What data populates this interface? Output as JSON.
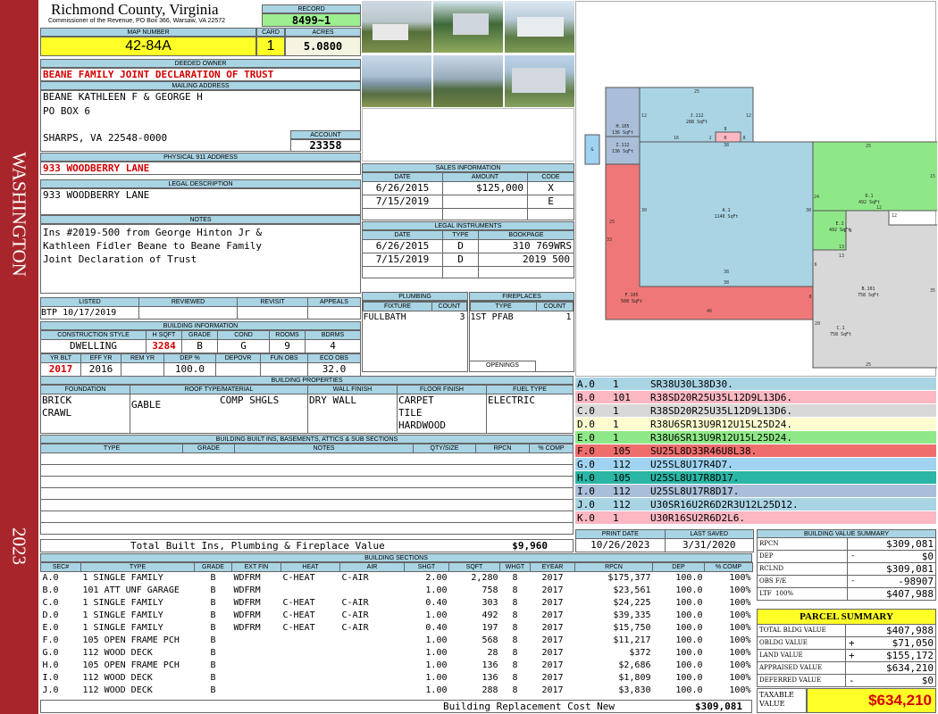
{
  "side": {
    "top": "WASHINGTON",
    "bottom": "2023"
  },
  "title": {
    "county": "Richmond County, Virginia",
    "sub": "Commissioner of the Revenue, PO Box 366, Warsaw, VA 22572"
  },
  "record": {
    "label": "RECORD",
    "value": "8499~1"
  },
  "map": {
    "map_label": "MAP NUMBER",
    "map_value": "42-84A",
    "card_label": "CARD",
    "card_value": "1",
    "acres_label": "ACRES",
    "acres_value": "5.0800"
  },
  "owner": {
    "label": "DEEDED OWNER",
    "value": "BEANE FAMILY JOINT DECLARATION OF TRUST"
  },
  "mailing": {
    "label": "MAILING ADDRESS",
    "line1": "BEANE KATHLEEN F & GEORGE H",
    "line2": "PO BOX 6",
    "line3": "SHARPS, VA 22548-0000"
  },
  "account": {
    "label": "ACCOUNT",
    "value": "23358"
  },
  "physical": {
    "label": "PHYSICAL 911 ADDRESS",
    "value": "933 WOODBERRY LANE"
  },
  "legal": {
    "label": "LEGAL DESCRIPTION",
    "value": "933 WOODBERRY LANE"
  },
  "notes": {
    "label": "NOTES",
    "lines": [
      "Ins #2019-500 from George Hinton Jr &",
      "Kathleen Fidler Beane to Beane Family",
      "Joint Declaration of Trust"
    ]
  },
  "listed": {
    "listed_label": "LISTED",
    "listed_value": "BTP 10/17/2019",
    "reviewed_label": "REVIEWED",
    "revisit_label": "REVISIT",
    "appeals_label": "APPEALS"
  },
  "building_info": {
    "label": "BUILDING INFORMATION",
    "h1": [
      "CONSTRUCTION STYLE",
      "H SQFT",
      "GRADE",
      "COND",
      "ROOMS",
      "BDRMS"
    ],
    "v1": [
      "DWELLING",
      "3284",
      "B",
      "G",
      "9",
      "4"
    ],
    "h2": [
      "YR BLT",
      "EFF YR",
      "REM YR",
      "DEP %",
      "DEPOVR",
      "FUN OBS",
      "ECO OBS"
    ],
    "v2": [
      "2017",
      "2016",
      "",
      "100.0",
      "",
      "",
      "32.0"
    ]
  },
  "building_props": {
    "label": "BUILDING PROPERTIES",
    "headers": [
      "FOUNDATION",
      "ROOF TYPE/MATERIAL",
      "WALL FINISH",
      "FLOOR FINISH",
      "FUEL TYPE"
    ],
    "foundation": [
      "BRICK",
      "CRAWL"
    ],
    "roof1": "GABLE",
    "roof2": "COMP SHGLS",
    "wall": "DRY WALL",
    "floor": [
      "CARPET",
      "TILE",
      "HARDWOOD"
    ],
    "fuel": "ELECTRIC"
  },
  "builtins": {
    "label": "BUILDING BUILT INS, BASEMENTS, ATTICS & SUB SECTIONS",
    "headers": [
      "TYPE",
      "GRADE",
      "NOTES",
      "QTY/SIZE",
      "RPCN",
      "% COMP"
    ],
    "total_label": "Total Built Ins, Plumbing & Fireplace Value",
    "total_value": "$9,960"
  },
  "sales": {
    "label": "SALES INFORMATION",
    "headers": [
      "DATE",
      "AMOUNT",
      "CODE"
    ],
    "rows": [
      [
        "6/26/2015",
        "$125,000",
        "X"
      ],
      [
        "7/15/2019",
        "",
        "E"
      ]
    ]
  },
  "instruments": {
    "label": "LEGAL INSTRUMENTS",
    "headers": [
      "DATE",
      "TYPE",
      "BOOKPAGE"
    ],
    "rows": [
      [
        "6/26/2015",
        "D",
        "310 769WRS"
      ],
      [
        "7/15/2019",
        "D",
        "2019 500"
      ]
    ]
  },
  "plumbing": {
    "label": "PLUMBING",
    "headers": [
      "FIXTURE",
      "COUNT"
    ],
    "rows": [
      [
        "FULLBATH",
        "3"
      ]
    ]
  },
  "fireplaces": {
    "label": "FIREPLACES",
    "headers": [
      "TYPE",
      "COUNT"
    ],
    "rows": [
      [
        "1ST PFAB",
        "1"
      ]
    ],
    "openings": "OPENINGS"
  },
  "sketch": {
    "rooms": [
      {
        "id": "H.105",
        "sq": "136 SqFt"
      },
      {
        "id": "I.112",
        "sq": "136 SqFt"
      },
      {
        "id": "J.112",
        "sq": "288 SqFt"
      },
      {
        "id": "K",
        "sq": ""
      },
      {
        "id": "G",
        "sq": ""
      },
      {
        "id": "A.1",
        "sq": "1140 SqFt"
      },
      {
        "id": "D.1",
        "sq": "492 SqFt"
      },
      {
        "id": "E.1",
        "sq": "492 SqFt"
      },
      {
        "id": "F.105",
        "sq": "568 SqFt"
      },
      {
        "id": "B.101",
        "sq": "758 SqFt"
      },
      {
        "id": "C.1",
        "sq": "758 SqFt"
      }
    ],
    "dims": [
      "25",
      "12",
      "12",
      "16",
      "2",
      "8",
      "8",
      "38",
      "25",
      "24",
      "15",
      "30",
      "30",
      "12",
      "12",
      "9 9",
      "13",
      "13",
      "25",
      "6",
      "33",
      "38",
      "38",
      "8",
      "46",
      "35",
      "20",
      "25"
    ]
  },
  "vectors": [
    {
      "code": "A.0",
      "n": "1",
      "v": "SR38U30L38D30.",
      "color": "#a9d4e4"
    },
    {
      "code": "B.0",
      "n": "101",
      "v": "R38SD20R25U35L12D9L13D6.",
      "color": "#fbb7c2"
    },
    {
      "code": "C.0",
      "n": "1",
      "v": "R38SD20R25U35L12D9L13D6.",
      "color": "#d8d8d8"
    },
    {
      "code": "D.0",
      "n": "1",
      "v": "R38U6SR13U9R12U15L25D24.",
      "color": "#fdfdd0"
    },
    {
      "code": "E.0",
      "n": "1",
      "v": "R38U6SR13U9R12U15L25D24.",
      "color": "#8fe887"
    },
    {
      "code": "F.0",
      "n": "105",
      "v": "SU25L8D33R46U8L38.",
      "color": "#ef6d6d"
    },
    {
      "code": "G.0",
      "n": "112",
      "v": "U25SL8U17R4D7.",
      "color": "#9fd3f1"
    },
    {
      "code": "H.0",
      "n": "105",
      "v": "U25SL8U17R8D17.",
      "color": "#2bb5a5"
    },
    {
      "code": "I.0",
      "n": "112",
      "v": "U25SL8U17R8D17.",
      "color": "#a9bed8"
    },
    {
      "code": "J.0",
      "n": "112",
      "v": "U30SR16U2R6D2R3U12L25D12.",
      "color": "#a9d4e4"
    },
    {
      "code": "K.0",
      "n": "1",
      "v": "U30R16SU2R6D2L6.",
      "color": "#fbb7c2"
    }
  ],
  "dates": {
    "print_label": "PRINT DATE",
    "print_value": "10/26/2023",
    "saved_label": "LAST SAVED",
    "saved_value": "3/31/2020"
  },
  "bvs": {
    "label": "BUILDING VALUE SUMMARY",
    "rows": [
      [
        "RPCN",
        "",
        "$309,081"
      ],
      [
        "DEP",
        "-",
        "$0"
      ],
      [
        "RCLND",
        "",
        "$309,081"
      ],
      [
        "OBS F/E",
        "-",
        "-98907"
      ],
      [
        "LTF  100%",
        "",
        "$407,988"
      ]
    ]
  },
  "parcel": {
    "label": "PARCEL SUMMARY",
    "rows": [
      [
        "TOTAL BLDG VALUE",
        "",
        "$407,988"
      ],
      [
        "OBLDG VALUE",
        "+",
        "$71,050"
      ],
      [
        "LAND VALUE",
        "+",
        "$155,172"
      ],
      [
        "APPRAISED VALUE",
        "",
        "$634,210"
      ],
      [
        "DEFERRED VALUE",
        "-",
        "$0"
      ]
    ],
    "taxable_label": "TAXABLE VALUE",
    "taxable_value": "$634,210"
  },
  "sections": {
    "label": "BUILDING SECTIONS",
    "headers": [
      "SEC#",
      "TYPE",
      "GRADE",
      "EXT FIN",
      "HEAT",
      "AIR",
      "SHGT",
      "SQFT",
      "WHGT",
      "EYEAR",
      "RPCN",
      "DEP",
      "% COMP"
    ],
    "rows": [
      [
        "A.0",
        "1 SINGLE FAMILY",
        "B",
        "WDFRM",
        "C-HEAT",
        "C-AIR",
        "2.00",
        "2,280",
        "8",
        "2017",
        "$175,377",
        "100.0",
        "100%"
      ],
      [
        "B.0",
        "101 ATT UNF GARAGE",
        "B",
        "WDFRM",
        "",
        "",
        "1.00",
        "758",
        "8",
        "2017",
        "$23,561",
        "100.0",
        "100%"
      ],
      [
        "C.0",
        "1 SINGLE FAMILY",
        "B",
        "WDFRM",
        "C-HEAT",
        "C-AIR",
        "0.40",
        "303",
        "8",
        "2017",
        "$24,225",
        "100.0",
        "100%"
      ],
      [
        "D.0",
        "1 SINGLE FAMILY",
        "B",
        "WDFRM",
        "C-HEAT",
        "C-AIR",
        "1.00",
        "492",
        "8",
        "2017",
        "$39,335",
        "100.0",
        "100%"
      ],
      [
        "E.0",
        "1 SINGLE FAMILY",
        "B",
        "WDFRM",
        "C-HEAT",
        "C-AIR",
        "0.40",
        "197",
        "8",
        "2017",
        "$15,750",
        "100.0",
        "100%"
      ],
      [
        "F.0",
        "105 OPEN FRAME PCH",
        "B",
        "",
        "",
        "",
        "1.00",
        "568",
        "8",
        "2017",
        "$11,217",
        "100.0",
        "100%"
      ],
      [
        "G.0",
        "112 WOOD DECK",
        "B",
        "",
        "",
        "",
        "1.00",
        "28",
        "8",
        "2017",
        "$372",
        "100.0",
        "100%"
      ],
      [
        "H.0",
        "105 OPEN FRAME PCH",
        "B",
        "",
        "",
        "",
        "1.00",
        "136",
        "8",
        "2017",
        "$2,686",
        "100.0",
        "100%"
      ],
      [
        "I.0",
        "112 WOOD DECK",
        "B",
        "",
        "",
        "",
        "1.00",
        "136",
        "8",
        "2017",
        "$1,809",
        "100.0",
        "100%"
      ],
      [
        "J.0",
        "112 WOOD DECK",
        "B",
        "",
        "",
        "",
        "1.00",
        "288",
        "8",
        "2017",
        "$3,830",
        "100.0",
        "100%"
      ]
    ],
    "replacement_label": "Building Replacement Cost New",
    "replacement_value": "$309,081"
  }
}
